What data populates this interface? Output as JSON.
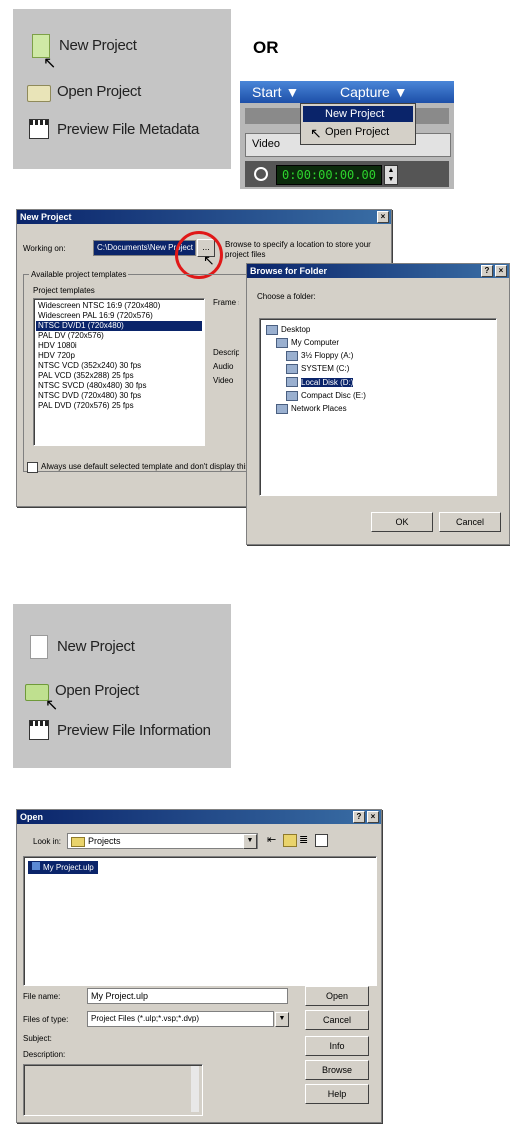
{
  "or_label": "OR",
  "menu1": {
    "items": [
      "New Project",
      "Open Project",
      "Preview File Metadata"
    ]
  },
  "menubar": {
    "tabs": [
      "Start ▼",
      "Capture ▼"
    ],
    "dropdown": [
      "New Project",
      "Open Project"
    ],
    "video_label": "Video",
    "timecode": "0:00:00:00.00"
  },
  "new_project_dialog": {
    "title": "New Project",
    "path_label": "Working on:",
    "path_value": "C:\\Documents\\New Project",
    "browse_label": "...",
    "help_text": "Browse to specify a location to store your project files",
    "group_label": "Available project templates",
    "list_header": "Project templates",
    "templates": [
      "Widescreen NTSC 16:9 (720x480)",
      "Widescreen PAL 16:9 (720x576)",
      "NTSC DV/D1 (720x480)",
      "PAL DV (720x576)",
      "HDV 1080i",
      "HDV 720p",
      "NTSC VCD (352x240) 30 fps",
      "PAL VCD (352x288) 25 fps",
      "NTSC SVCD (480x480) 30 fps",
      "NTSC DVD (720x480) 30 fps",
      "PAL DVD (720x576) 25 fps"
    ],
    "selected_index": 2,
    "side_labels": [
      "Frame size",
      "Description",
      "Audio",
      "Video"
    ],
    "checkbox_label": "Always use default selected template and don't display this dialog"
  },
  "browse_dialog": {
    "title": "Browse for Folder",
    "close": "?",
    "prompt": "Choose a folder:",
    "tree": [
      "Desktop",
      "My Computer",
      "3½ Floppy (A:)",
      "SYSTEM (C:)",
      "Local Disk (D:)",
      "Compact Disc (E:)",
      "Network Places"
    ],
    "selected_index": 4,
    "ok": "OK",
    "cancel": "Cancel"
  },
  "menu2": {
    "items": [
      "New Project",
      "Open Project",
      "Preview File Information"
    ]
  },
  "open_dialog": {
    "title": "Open",
    "look_in_label": "Look in:",
    "look_in_value": "Projects",
    "file_item": "My Project.ulp",
    "filename_label": "File name:",
    "filename_value": "My Project.ulp",
    "filetype_label": "Files of type:",
    "filetype_value": "Project Files (*.ulp;*.vsp;*.dvp)",
    "subject_label": "Subject:",
    "description_label": "Description:",
    "buttons": [
      "Open",
      "Cancel",
      "Info",
      "Browse",
      "Help"
    ]
  },
  "colors": {
    "accent": "#0a246a",
    "highlight_red": "#e01818",
    "panel": "#c5c5c5",
    "timecode_green": "#2dd32d"
  }
}
